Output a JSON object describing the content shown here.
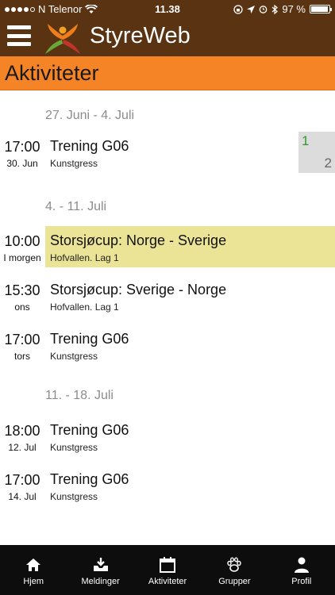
{
  "status": {
    "carrier": "N Telenor",
    "time": "11.38",
    "battery": "97 %",
    "battery_level": 0.97
  },
  "nav": {
    "brand": "StyreWeb"
  },
  "section": {
    "title": "Aktiviteter"
  },
  "weeks": [
    {
      "label": "27. Juni - 4. Juli",
      "items": [
        {
          "time": "17:00",
          "date": "30. Jun",
          "name": "Trening G06",
          "place": "Kunstgress",
          "count_yes": "1",
          "count_no": "2"
        }
      ]
    },
    {
      "label": "4. - 11. Juli",
      "items": [
        {
          "time": "10:00",
          "date": "I morgen",
          "name": "Storsjøcup: Norge - Sverige",
          "place": "Hofvallen. Lag 1",
          "highlight": "#ebe396"
        },
        {
          "time": "15:30",
          "date": "ons",
          "name": "Storsjøcup: Sverige - Norge",
          "place": "Hofvallen. Lag 1"
        },
        {
          "time": "17:00",
          "date": "tors",
          "name": "Trening G06",
          "place": "Kunstgress"
        }
      ]
    },
    {
      "label": "11. - 18. Juli",
      "items": [
        {
          "time": "18:00",
          "date": "12. Jul",
          "name": "Trening G06",
          "place": "Kunstgress"
        },
        {
          "time": "17:00",
          "date": "14. Jul",
          "name": "Trening G06",
          "place": "Kunstgress"
        }
      ]
    }
  ],
  "tabs": [
    {
      "label": "Hjem",
      "icon": "home-icon"
    },
    {
      "label": "Meldinger",
      "icon": "inbox-icon"
    },
    {
      "label": "Aktiviteter",
      "icon": "calendar-icon"
    },
    {
      "label": "Grupper",
      "icon": "paw-icon"
    },
    {
      "label": "Profil",
      "icon": "person-icon"
    }
  ],
  "colors": {
    "header": "#5a3312",
    "titlebar": "#f58426",
    "highlight": "#ebe396",
    "count_yes": "#2e9a2e"
  }
}
